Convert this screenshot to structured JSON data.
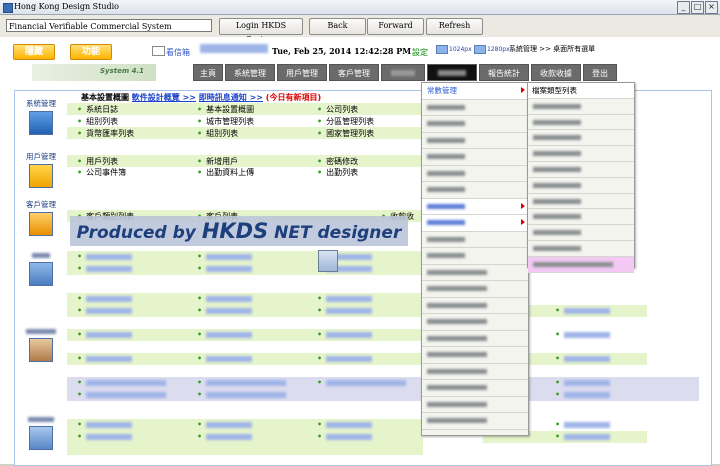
{
  "window": {
    "title": "Hong Kong Design Studio"
  },
  "toolbar": {
    "url": "Financial Verifiable Commercial System",
    "login_label": "Login HKDS System",
    "back_label": "Back",
    "forward_label": "Forward",
    "refresh_label": "Refresh"
  },
  "header": {
    "hide_label": "隱藏",
    "function_label": "功能",
    "mail_label": "看信箱",
    "datetime": "Tue, Feb 25, 2014 12:42:28 PM",
    "settings_label": "設定",
    "res1": "1024px",
    "res2": "1280px",
    "breadcrumb": "系統管理 >> 桌面所有選單",
    "logo_text": "System 4.1"
  },
  "nav": {
    "items": [
      "主頁",
      "系統管理",
      "用戶管理",
      "客戶管理",
      "",
      "",
      "報告統計",
      "收款收據",
      "登出"
    ]
  },
  "content": {
    "top_line_label": "基本設置概圖",
    "top_link1": "軟件設計概覽 >>",
    "top_link2": "即時訊息通知 >>",
    "top_new": "(今日有新項目)",
    "sections": {
      "system": "系統管理",
      "user": "用戶管理",
      "customer": "客戶管理"
    },
    "system_items": [
      "系統日誌",
      "基本設置概圖",
      "公司列表",
      "組別列表",
      "城市管理列表",
      "分區管理列表",
      "貨幣匯率列表",
      "組別列表",
      "國家管理列表"
    ],
    "user_items": [
      "用戶列表",
      "新增用戶",
      "密碼修改",
      "公司事件簿",
      "出勤資料上傳",
      "出勤列表"
    ],
    "customer_items": [
      "客戶類別列表",
      "客戶列表",
      "收款收"
    ]
  },
  "banner": {
    "part1": "Produced by",
    "part2": "HKDS",
    "part3": "NET designer"
  },
  "menus": {
    "menu1_first": "常數管理",
    "menu2_first": "檔案類型列表"
  }
}
